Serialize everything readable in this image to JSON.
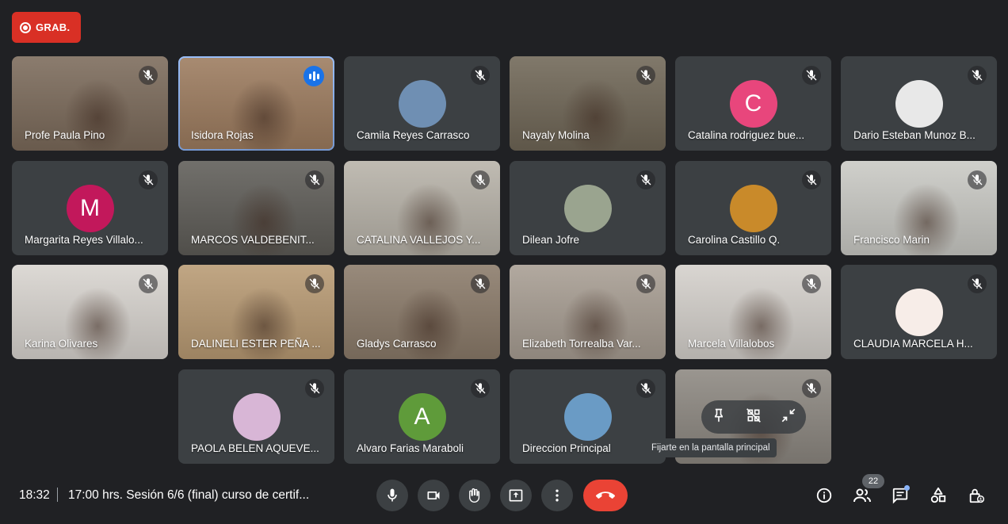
{
  "recording": {
    "label": "GRAB."
  },
  "participants": [
    {
      "name": "Profe Paula Pino",
      "type": "video",
      "bg": "#7b6a5a",
      "muted": true
    },
    {
      "name": "Isidora Rojas",
      "type": "video",
      "bg": "#9c7b5e",
      "muted": false,
      "speaking": true
    },
    {
      "name": "Camila Reyes Carrasco",
      "type": "photo",
      "bg": "#3c4043",
      "avatar_bg": "#6f8fb3",
      "muted": true
    },
    {
      "name": "Nayaly Molina",
      "type": "video",
      "bg": "#6f6656",
      "muted": true
    },
    {
      "name": "Catalina rodriguez bue...",
      "type": "letter",
      "bg": "#3c4043",
      "avatar_bg": "#e8467c",
      "letter": "C",
      "muted": true
    },
    {
      "name": "Dario Esteban Munoz B...",
      "type": "photo",
      "bg": "#3c4043",
      "avatar_bg": "#e8e8e8",
      "muted": true
    },
    {
      "name": "Margarita Reyes Villalo...",
      "type": "letter",
      "bg": "#3c4043",
      "avatar_bg": "#c2185b",
      "letter": "M",
      "muted": true
    },
    {
      "name": "MARCOS VALDEBENIT...",
      "type": "video",
      "bg": "#5e5c57",
      "muted": true
    },
    {
      "name": "CATALINA VALLEJOS Y...",
      "type": "video",
      "bg": "#b7b2a8",
      "muted": true
    },
    {
      "name": "Dilean Jofre",
      "type": "photo",
      "bg": "#3c4043",
      "avatar_bg": "#9aa48f",
      "muted": true
    },
    {
      "name": "Carolina Castillo Q.",
      "type": "photo",
      "bg": "#3c4043",
      "avatar_bg": "#c98a2a",
      "muted": true
    },
    {
      "name": "Francisco Marin",
      "type": "video",
      "bg": "#c9c9c4",
      "muted": true
    },
    {
      "name": "Karina Olivares",
      "type": "video",
      "bg": "#d8d4cf",
      "muted": true
    },
    {
      "name": "DALINELI ESTER PEÑA ...",
      "type": "video",
      "bg": "#b89a73",
      "muted": true
    },
    {
      "name": "Gladys Carrasco",
      "type": "video",
      "bg": "#8a7a69",
      "muted": true
    },
    {
      "name": "Elizabeth Torrealba Var...",
      "type": "video",
      "bg": "#a79d92",
      "muted": true
    },
    {
      "name": "Marcela Villalobos",
      "type": "video",
      "bg": "#d4d0cb",
      "muted": true
    },
    {
      "name": "CLAUDIA MARCELA H...",
      "type": "photo",
      "bg": "#3c4043",
      "avatar_bg": "#f7ede8",
      "muted": true
    },
    {
      "name": "PAOLA BELEN AQUEVE...",
      "type": "photo",
      "bg": "#3c4043",
      "avatar_bg": "#d8b6d6",
      "muted": true
    },
    {
      "name": "Alvaro Farias Maraboli",
      "type": "letter",
      "bg": "#3c4043",
      "avatar_bg": "#5f9b3a",
      "letter": "A",
      "muted": true
    },
    {
      "name": "Direccion Principal",
      "type": "photo",
      "bg": "#3c4043",
      "avatar_bg": "#6a9bc5",
      "muted": true
    },
    {
      "name": "",
      "type": "video",
      "bg": "#8c8780",
      "muted": true,
      "hovered": true
    }
  ],
  "tooltip": "Fijarte en la pantalla principal",
  "bottom_bar": {
    "time": "18:32",
    "meeting_title": "17:00 hrs. Sesión 6/6 (final) curso de certif...",
    "participant_count": "22"
  }
}
